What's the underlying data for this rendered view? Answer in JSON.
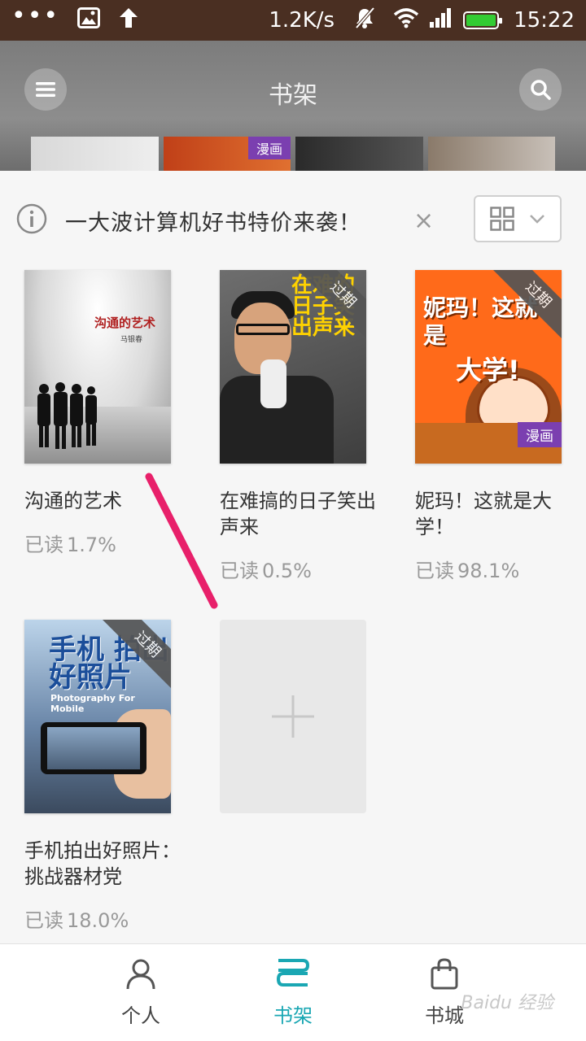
{
  "status_bar": {
    "dots": "•••",
    "net_speed": "1.2K/s",
    "time": "15:22"
  },
  "header": {
    "title": "书架",
    "strip_badge": "漫画"
  },
  "promo": {
    "text": "一大波计算机好书特价来袭！",
    "close": "×"
  },
  "books": [
    {
      "title": "沟通的艺术",
      "progress_label": "已读",
      "progress": "1.7%",
      "cover_title": "沟通的艺术",
      "cover_author": "马银春"
    },
    {
      "title": "在难搞的日子笑出声来",
      "progress_label": "已读",
      "progress": "0.5%",
      "expired": "过期",
      "cover_title": "在难的日子笑出声来"
    },
    {
      "title": "妮玛！这就是大学！",
      "progress_label": "已读",
      "progress": "98.1%",
      "expired": "过期",
      "tag": "漫画",
      "cover_title": "妮玛！这就是",
      "cover_title2": "大学!"
    },
    {
      "title": "手机拍出好照片：挑战器材党",
      "progress_label": "已读",
      "progress": "18.0%",
      "expired": "过期",
      "cover_title": "手机 拍出好照片",
      "cover_sub": "Photography For Mobile"
    }
  ],
  "nav": {
    "personal": "个人",
    "shelf": "书架",
    "store": "书城"
  },
  "watermark": "Baidu 经验",
  "colors": {
    "accent": "#1aa7b3",
    "status_bar": "#4a2f22",
    "expired_ribbon": "#555555",
    "manga_tag": "#7b3fb0",
    "annotation_stroke": "#e8206a"
  }
}
